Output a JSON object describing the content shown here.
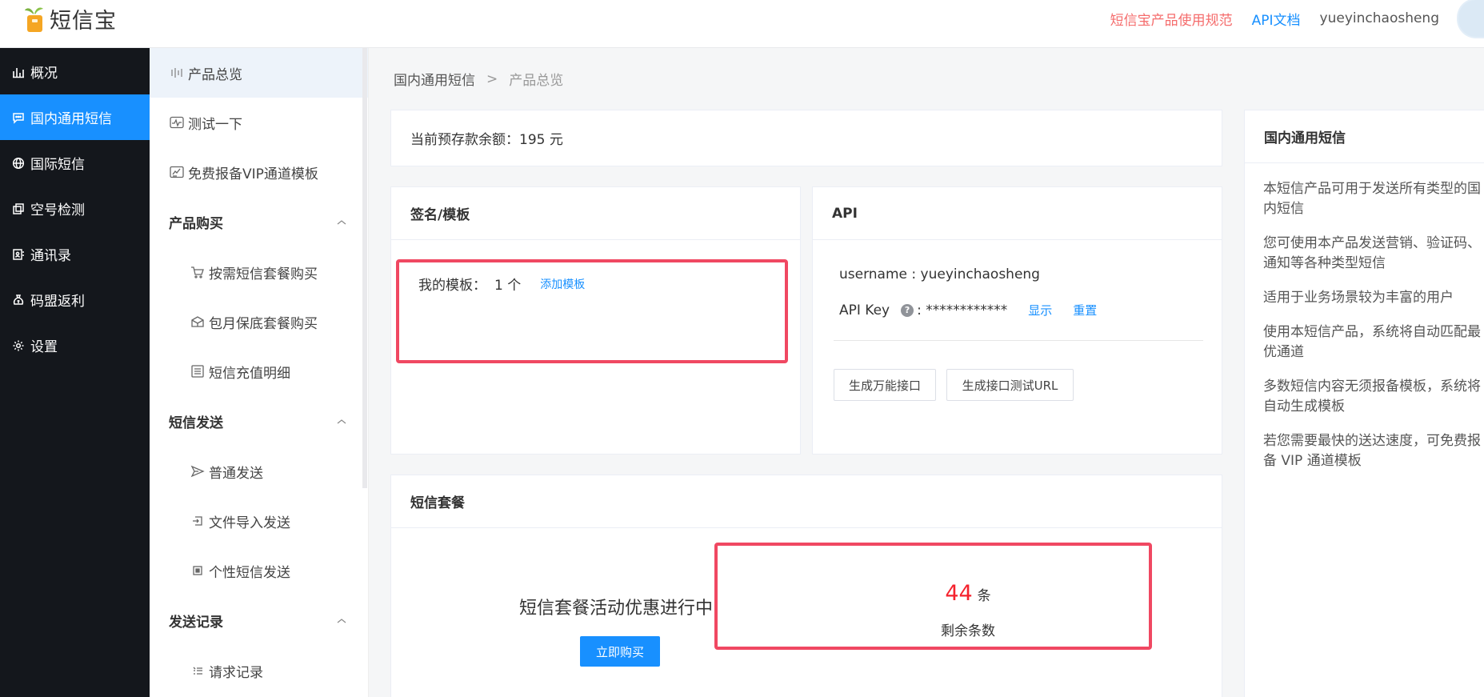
{
  "header": {
    "logo_text": "短信宝",
    "links": [
      {
        "label": "短信宝产品使用规范",
        "color": "#f56c6c"
      },
      {
        "label": "API文档",
        "color": "#1890ff"
      }
    ],
    "username": "yueyinchaosheng"
  },
  "sidebar": {
    "items": [
      {
        "label": "概况",
        "icon": "bar-chart-icon"
      },
      {
        "label": "国内通用短信",
        "icon": "message-icon",
        "active": true
      },
      {
        "label": "国际短信",
        "icon": "globe-icon"
      },
      {
        "label": "空号检测",
        "icon": "copy-icon"
      },
      {
        "label": "通讯录",
        "icon": "contacts-icon"
      },
      {
        "label": "码盟返利",
        "icon": "money-bag-icon"
      },
      {
        "label": "设置",
        "icon": "gear-icon"
      }
    ]
  },
  "submenu": {
    "top_items": [
      {
        "label": "产品总览",
        "icon": "bars-icon",
        "active": true
      },
      {
        "label": "测试一下",
        "icon": "pulse-icon"
      },
      {
        "label": "免费报备VIP通道模板",
        "icon": "chart-doc-icon"
      }
    ],
    "groups": [
      {
        "label": "产品购买",
        "items": [
          {
            "label": "按需短信套餐购买",
            "icon": "cart-icon"
          },
          {
            "label": "包月保底套餐购买",
            "icon": "gift-box-icon"
          },
          {
            "label": "短信充值明细",
            "icon": "list-icon"
          }
        ]
      },
      {
        "label": "短信发送",
        "items": [
          {
            "label": "普通发送",
            "icon": "send-icon"
          },
          {
            "label": "文件导入发送",
            "icon": "import-icon"
          },
          {
            "label": "个性短信发送",
            "icon": "square-dot-icon"
          }
        ]
      },
      {
        "label": "发送记录",
        "items": [
          {
            "label": "请求记录",
            "icon": "record-list-icon"
          }
        ]
      }
    ]
  },
  "breadcrumb": {
    "parent": "国内通用短信",
    "separator": ">",
    "current": "产品总览"
  },
  "balance": {
    "text": "当前预存款余额：195 元"
  },
  "signature": {
    "title": "签名/模板",
    "my_template_label": "我的模板：",
    "my_template_count": "1 个",
    "add_template": "添加模板"
  },
  "api": {
    "title": "API",
    "username_line": "username : yueyinchaosheng",
    "api_key_label": "API Key",
    "api_key_value": ": ************",
    "show": "显示",
    "reset": "重置",
    "btn_universal": "生成万能接口",
    "btn_test_url": "生成接口测试URL"
  },
  "package": {
    "title": "短信套餐",
    "promo": "短信套餐活动优惠进行中",
    "buy": "立即购买",
    "remaining_count": "44",
    "remaining_unit": "条",
    "remaining_label": "剩余条数"
  },
  "info": {
    "title": "国内通用短信",
    "paragraphs": [
      "本短信产品可用于发送所有类型的国内短信",
      "您可使用本产品发送营销、验证码、通知等各种类型短信",
      "适用于业务场景较为丰富的用户",
      "使用本短信产品，系统将自动匹配最优通道",
      "多数短信内容无须报备模板，系统将自动生成模板",
      "若您需要最快的送达速度，可免费报备 VIP 通道模板"
    ]
  },
  "colors": {
    "primary": "#1890ff",
    "highlight": "#f04862",
    "sidebar_bg": "#14171c"
  }
}
